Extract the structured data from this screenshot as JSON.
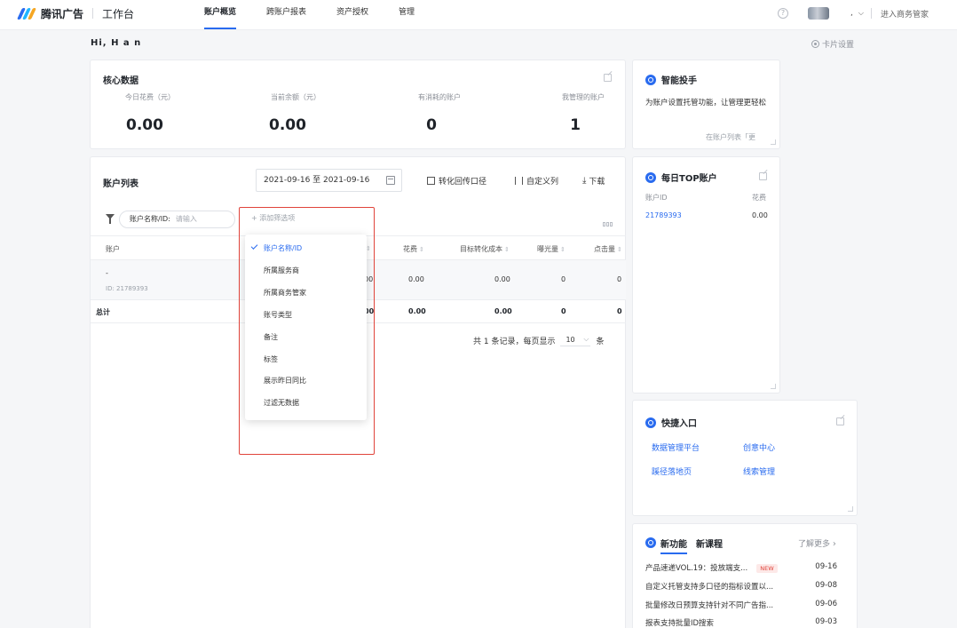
{
  "brand": {
    "name": "腾讯广告",
    "workbench": "工作台"
  },
  "nav": [
    "账户概览",
    "跨账户报表",
    "资产授权",
    "管理"
  ],
  "topbar": {
    "user_comma": ",",
    "enter": "进入商务管家"
  },
  "greeting": "Hi, H a n",
  "card_settings": "卡片设置",
  "core": {
    "title": "核心数据",
    "metrics": [
      {
        "label": "今日花费（元）",
        "value": "0.00"
      },
      {
        "label": "当前余额（元）",
        "value": "0.00"
      },
      {
        "label": "有消耗的账户",
        "value": "0"
      },
      {
        "label": "我管理的账户",
        "value": "1"
      }
    ]
  },
  "assistant": {
    "title": "智能投手",
    "desc": "为账户设置托管功能，让管理更轻松",
    "footer": "在账户列表「更"
  },
  "accounts": {
    "title": "账户列表",
    "date_range": "2021-09-16 至 2021-09-16",
    "tools": [
      "转化回传口径",
      "自定义列",
      "下载"
    ],
    "filter_label": "账户名称/ID:",
    "filter_placeholder": "请输入",
    "add_filter": "+ 添加筛选项",
    "columns": [
      "账户",
      "花费",
      "目标转化成本",
      "曝光量",
      "点击量"
    ],
    "row": {
      "name": "-",
      "id": "ID: 21789393",
      "partial": "00",
      "cost": "0.00",
      "target_cost": "0.00",
      "impressions": "0",
      "clicks": "0"
    },
    "total": {
      "label": "总计",
      "partial": "00",
      "cost": "0.00",
      "target_cost": "0.00",
      "impressions": "0",
      "clicks": "0"
    },
    "pager": {
      "prefix": "共 1 条记录，每页显示",
      "size": "10",
      "suffix": "条"
    }
  },
  "dropdown": [
    "账户名称/ID",
    "所属服务商",
    "所属商务管家",
    "账号类型",
    "备注",
    "标签",
    "展示昨日同比",
    "过滤无数据"
  ],
  "top_accounts": {
    "title": "每日TOP账户",
    "col_id": "账户ID",
    "col_cost": "花费",
    "rows": [
      {
        "id": "21789393",
        "cost": "0.00"
      }
    ]
  },
  "quick": {
    "title": "快捷入口",
    "links": [
      "数据管理平台",
      "创意中心",
      "蹊径落地页",
      "线索管理"
    ]
  },
  "news": {
    "tabs": [
      "新功能",
      "新课程"
    ],
    "more": "了解更多",
    "items": [
      {
        "title": "产品速递VOL.19：投放端支...",
        "badge": "NEW",
        "date": "09-16"
      },
      {
        "title": "自定义托管支持多口径的指标设置以...",
        "date": "09-08"
      },
      {
        "title": "批量修改日预算支持针对不同广告指...",
        "date": "09-06"
      },
      {
        "title": "报表支持批量ID搜索",
        "date": "09-03"
      }
    ]
  },
  "colors": {
    "accent": "#296bef",
    "highlight": "#e0443b"
  }
}
